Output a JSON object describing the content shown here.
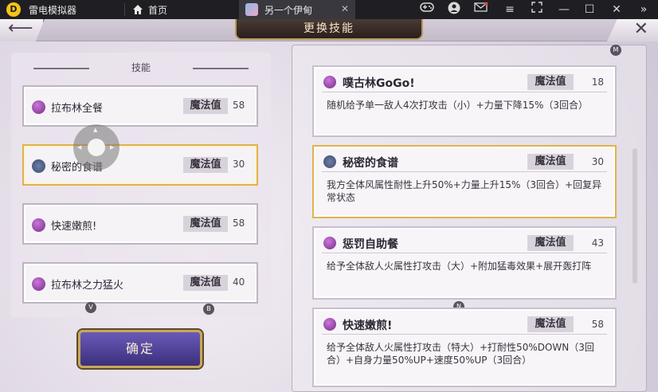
{
  "window": {
    "app_name": "雷电模拟器",
    "home_tab": "首页",
    "game_tab": "另一个伊甸"
  },
  "screen": {
    "title": "更换技能"
  },
  "left": {
    "header": "技能",
    "skills": [
      {
        "name": "拉布林全餐",
        "mp_label": "魔法值",
        "mp": "58",
        "icon": "fire-skill-icon"
      },
      {
        "name": "秘密的食谱",
        "mp_label": "魔法值",
        "mp": "30",
        "icon": "wind-skill-icon",
        "selected": true
      },
      {
        "name": "快速嫩煎!",
        "mp_label": "魔法值",
        "mp": "58",
        "icon": "fire-skill-icon"
      },
      {
        "name": "拉布林之力猛火",
        "mp_label": "魔法值",
        "mp": "40",
        "icon": "fire-skill-icon"
      }
    ],
    "confirm": "确定",
    "key_hints": {
      "v": "V",
      "b": "B"
    }
  },
  "right": {
    "key_hints": {
      "m": "M",
      "n": "N"
    },
    "cards": [
      {
        "name": "噗古林GoGo!",
        "mp_label": "魔法值",
        "mp": "18",
        "desc": "随机给予单一敌人4次打攻击（小）+力量下降15%（3回合）"
      },
      {
        "name": "秘密的食谱",
        "mp_label": "魔法值",
        "mp": "30",
        "desc": "我方全体风属性耐性上升50%+力量上升15%（3回合）+回复异常状态"
      },
      {
        "name": "惩罚自助餐",
        "mp_label": "魔法值",
        "mp": "43",
        "desc": "给予全体敌人火属性打攻击（大）+附加猛毒效果+展开轰打阵"
      },
      {
        "name": "快速嫩煎!",
        "mp_label": "魔法值",
        "mp": "58",
        "desc": "给予全体敌人火属性打攻击（特大）+打耐性50%DOWN（3回合）+自身力量50%UP+速度50%UP（3回合）"
      }
    ]
  },
  "colors": {
    "accent_gold": "#e2b24a",
    "confirm_purple": "#4b3d96",
    "titlebar": "#1f1f23"
  }
}
